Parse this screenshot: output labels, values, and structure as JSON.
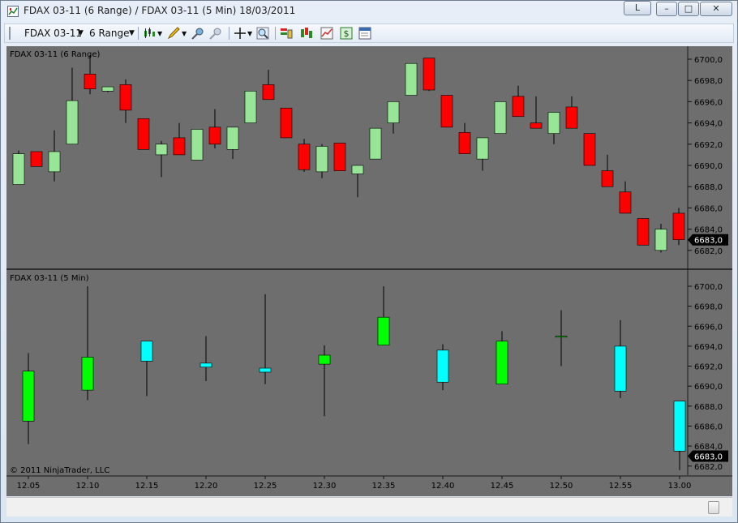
{
  "window": {
    "title": "FDAX 03-11 (6 Range) / FDAX 03-11 (5 Min)  18/03/2011",
    "controls": {
      "shortcut_label": "L",
      "minimize": "–",
      "maximize": "□",
      "close": "✕"
    }
  },
  "toolbar": {
    "instrument": "FDAX 03-11",
    "interval": "6 Range",
    "icons": [
      "chart-style-icon",
      "drawing-tool-icon",
      "zoom-in-icon",
      "zoom-out-icon",
      "crosshair-icon",
      "magnify-icon",
      "indicators-icon",
      "strategies-icon",
      "data-series-icon",
      "money-icon",
      "properties-icon"
    ]
  },
  "colors": {
    "chart_bg": "#6e6e6e",
    "axis_bg": "#6e6e6e",
    "grid": "#7a7a7a",
    "text": "#000000",
    "up_top": "#98e598",
    "down_top": "#ff0000",
    "up_bottom": "#00ff00",
    "down_bottom": "#00ffff",
    "wick": "#000000",
    "last_price_bg": "#000000",
    "last_price_fg": "#ffffff"
  },
  "chart_data": [
    {
      "type": "candlestick",
      "panel": "top",
      "label": "FDAX 03-11 (6 Range)",
      "y_ticks": [
        "6700,0",
        "6698,0",
        "6696,0",
        "6694,0",
        "6692,0",
        "6690,0",
        "6688,0",
        "6686,0",
        "6684,0",
        "6682,0"
      ],
      "ylim": [
        6681,
        6700.5
      ],
      "last_price": "6683,0",
      "bars": [
        {
          "open": 6688.2,
          "close": 6691.1,
          "high": 6691.4,
          "low": 6688.2
        },
        {
          "open": 6691.3,
          "close": 6689.9,
          "high": 6691.3,
          "low": 6689.9
        },
        {
          "open": 6689.4,
          "close": 6691.3,
          "high": 6693.3,
          "low": 6688.5
        },
        {
          "open": 6692.0,
          "close": 6696.1,
          "high": 6699.2,
          "low": 6692.0
        },
        {
          "open": 6698.6,
          "close": 6697.2,
          "high": 6700.4,
          "low": 6696.7
        },
        {
          "open": 6697.0,
          "close": 6697.4,
          "high": 6697.4,
          "low": 6696.9
        },
        {
          "open": 6697.6,
          "close": 6695.2,
          "high": 6698.1,
          "low": 6694.0
        },
        {
          "open": 6694.4,
          "close": 6691.5,
          "high": 6694.4,
          "low": 6691.5
        },
        {
          "open": 6691.0,
          "close": 6692.0,
          "high": 6692.3,
          "low": 6688.9
        },
        {
          "open": 6692.6,
          "close": 6691.0,
          "high": 6694.0,
          "low": 6691.0
        },
        {
          "open": 6690.5,
          "close": 6693.4,
          "high": 6693.4,
          "low": 6690.5
        },
        {
          "open": 6693.6,
          "close": 6692.0,
          "high": 6695.3,
          "low": 6691.6
        },
        {
          "open": 6691.5,
          "close": 6693.6,
          "high": 6693.6,
          "low": 6690.6
        },
        {
          "open": 6694.0,
          "close": 6697.0,
          "high": 6697.0,
          "low": 6694.0
        },
        {
          "open": 6697.6,
          "close": 6696.2,
          "high": 6699.0,
          "low": 6696.2
        },
        {
          "open": 6695.4,
          "close": 6692.6,
          "high": 6695.4,
          "low": 6692.6
        },
        {
          "open": 6692.0,
          "close": 6689.6,
          "high": 6692.5,
          "low": 6689.4
        },
        {
          "open": 6689.4,
          "close": 6691.8,
          "high": 6692.0,
          "low": 6688.8
        },
        {
          "open": 6692.1,
          "close": 6689.5,
          "high": 6692.1,
          "low": 6689.5
        },
        {
          "open": 6689.2,
          "close": 6690.0,
          "high": 6690.0,
          "low": 6687.0
        },
        {
          "open": 6690.6,
          "close": 6693.5,
          "high": 6693.5,
          "low": 6690.6
        },
        {
          "open": 6694.0,
          "close": 6696.0,
          "high": 6696.0,
          "low": 6693.0
        },
        {
          "open": 6696.6,
          "close": 6699.6,
          "high": 6699.6,
          "low": 6696.6
        },
        {
          "open": 6700.1,
          "close": 6697.1,
          "high": 6700.1,
          "low": 6697.0
        },
        {
          "open": 6696.6,
          "close": 6693.6,
          "high": 6696.6,
          "low": 6693.6
        },
        {
          "open": 6693.1,
          "close": 6691.1,
          "high": 6694.0,
          "low": 6691.1
        },
        {
          "open": 6690.6,
          "close": 6692.6,
          "high": 6692.6,
          "low": 6689.5
        },
        {
          "open": 6693.0,
          "close": 6696.0,
          "high": 6696.0,
          "low": 6693.0
        },
        {
          "open": 6696.5,
          "close": 6694.6,
          "high": 6697.5,
          "low": 6694.6
        },
        {
          "open": 6694.0,
          "close": 6693.5,
          "high": 6696.5,
          "low": 6693.5
        },
        {
          "open": 6693.0,
          "close": 6695.0,
          "high": 6695.0,
          "low": 6692.0
        },
        {
          "open": 6695.5,
          "close": 6693.5,
          "high": 6696.5,
          "low": 6693.5
        },
        {
          "open": 6693.0,
          "close": 6690.0,
          "high": 6693.0,
          "low": 6690.0
        },
        {
          "open": 6689.5,
          "close": 6688.0,
          "high": 6691.0,
          "low": 6688.0
        },
        {
          "open": 6687.5,
          "close": 6685.5,
          "high": 6688.5,
          "low": 6685.5
        },
        {
          "open": 6685.0,
          "close": 6682.5,
          "high": 6685.0,
          "low": 6682.5
        },
        {
          "open": 6682.0,
          "close": 6684.0,
          "high": 6684.5,
          "low": 6681.8
        },
        {
          "open": 6685.5,
          "close": 6683.0,
          "high": 6686.0,
          "low": 6682.5
        }
      ]
    },
    {
      "type": "candlestick",
      "panel": "bottom",
      "label": "FDAX 03-11 (5 Min)",
      "y_ticks": [
        "6700,0",
        "6698,0",
        "6696,0",
        "6694,0",
        "6692,0",
        "6690,0",
        "6688,0",
        "6686,0",
        "6684,0",
        "6682,0"
      ],
      "ylim": [
        6681,
        6700.5
      ],
      "last_price": "6683,0",
      "watermark": "© 2011 NinjaTrader, LLC",
      "x_labels": [
        "12.05",
        "12.10",
        "12.15",
        "12.20",
        "12.25",
        "12.30",
        "12.35",
        "12.40",
        "12.45",
        "12.50",
        "12.55",
        "13.00"
      ],
      "bars": [
        {
          "open": 6686.5,
          "close": 6691.5,
          "high": 6693.3,
          "low": 6684.2
        },
        {
          "open": 6689.6,
          "close": 6692.9,
          "high": 6700.0,
          "low": 6688.6
        },
        {
          "open": 6694.5,
          "close": 6692.5,
          "high": 6694.5,
          "low": 6689.0
        },
        {
          "open": 6692.3,
          "close": 6691.9,
          "high": 6695.0,
          "low": 6690.5
        },
        {
          "open": 6691.8,
          "close": 6691.4,
          "high": 6699.2,
          "low": 6690.2
        },
        {
          "open": 6692.2,
          "close": 6693.1,
          "high": 6694.1,
          "low": 6687.0
        },
        {
          "open": 6694.1,
          "close": 6696.9,
          "high": 6700.0,
          "low": 6694.1
        },
        {
          "open": 6693.6,
          "close": 6690.4,
          "high": 6694.2,
          "low": 6689.6
        },
        {
          "open": 6690.2,
          "close": 6694.5,
          "high": 6695.5,
          "low": 6690.2
        },
        {
          "open": 6695.0,
          "close": 6695.0,
          "high": 6697.6,
          "low": 6692.0
        },
        {
          "open": 6694.0,
          "close": 6689.5,
          "high": 6696.6,
          "low": 6688.8
        },
        {
          "open": 6688.5,
          "close": 6683.5,
          "high": 6688.5,
          "low": 6681.6
        }
      ]
    }
  ]
}
